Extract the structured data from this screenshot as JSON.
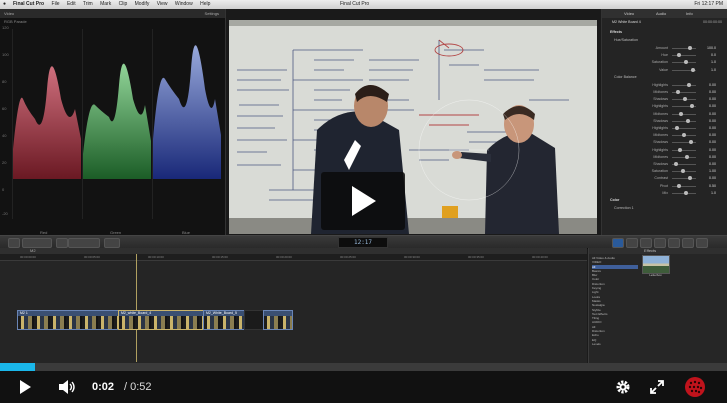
{
  "menubar": {
    "apple": "",
    "menus": [
      "Final Cut Pro",
      "File",
      "Edit",
      "Trim",
      "Mark",
      "Clip",
      "Modify",
      "View",
      "Window",
      "Help"
    ],
    "window_title": "Final Cut Pro",
    "clock": "Fri 12:17 PM"
  },
  "scopes": {
    "panel_label": "Video",
    "settings_label": "Settings",
    "scope_name": "RGB Parade",
    "scale": [
      "120",
      "100",
      "80",
      "60",
      "40",
      "20",
      "0",
      "-20"
    ],
    "channels": [
      "Red",
      "Green",
      "Blue"
    ],
    "colors": {
      "red": "#d8404a",
      "green": "#42c85a",
      "blue": "#5a7ae8"
    }
  },
  "viewer": {
    "whiteboard_notes": [
      "Voldemort",
      "McHugh Studios",
      "Tape Bros.",
      "Paid Society",
      "Crowd Funding",
      "Rochester",
      "Marketing",
      "Sales",
      "Film",
      "Bus. Plan",
      "Design Sheets"
    ]
  },
  "inspector": {
    "tabs": [
      "Video",
      "Audio",
      "Info"
    ],
    "clip_title": "M2 White Board 4",
    "clip_time": "00:00:00:00",
    "rows": [
      {
        "name": "Effects",
        "value": "",
        "kind": "head"
      },
      {
        "name": "Hue/Saturation",
        "value": "",
        "kind": "sec"
      },
      {
        "name": "Amount",
        "value": "100.0",
        "kind": "row"
      },
      {
        "name": "Hue",
        "value": "0.0",
        "kind": "row"
      },
      {
        "name": "Saturation",
        "value": "1.0",
        "kind": "row"
      },
      {
        "name": "Value",
        "value": "1.0",
        "kind": "row"
      },
      {
        "name": "Color Balance",
        "value": "",
        "kind": "sec"
      },
      {
        "name": "Highlights",
        "value": "0.00",
        "kind": "row"
      },
      {
        "name": "Midtones",
        "value": "0.00",
        "kind": "row"
      },
      {
        "name": "Shadows",
        "value": "0.00",
        "kind": "row"
      },
      {
        "name": "Highlights",
        "value": "0.00",
        "kind": "row"
      },
      {
        "name": "Midtones",
        "value": "0.00",
        "kind": "row"
      },
      {
        "name": "Shadows",
        "value": "0.00",
        "kind": "row"
      },
      {
        "name": "Highlights",
        "value": "0.00",
        "kind": "row"
      },
      {
        "name": "Midtones",
        "value": "0.00",
        "kind": "row"
      },
      {
        "name": "Shadows",
        "value": "0.00",
        "kind": "row"
      },
      {
        "name": "Highlights",
        "value": "0.00",
        "kind": "row"
      },
      {
        "name": "Midtones",
        "value": "0.00",
        "kind": "row"
      },
      {
        "name": "Shadows",
        "value": "0.00",
        "kind": "row"
      },
      {
        "name": "Saturation",
        "value": "1.00",
        "kind": "row"
      },
      {
        "name": "Contrast",
        "value": "0.00",
        "kind": "row"
      },
      {
        "name": "Pivot",
        "value": "0.50",
        "kind": "row"
      },
      {
        "name": "Mix",
        "value": "1.0",
        "kind": "row"
      },
      {
        "name": "Color",
        "value": "",
        "kind": "head"
      },
      {
        "name": "Correction 1",
        "value": "",
        "kind": "sec"
      }
    ]
  },
  "toolbar": {
    "timecode": "12:17"
  },
  "timeline": {
    "header": "M2",
    "ruler": [
      "00:00:00:00",
      "00:00:05:00",
      "00:00:10:00",
      "00:00:15:00",
      "00:00:20:00",
      "00:00:25:00",
      "00:00:30:00",
      "00:00:35:00",
      "00:00:40:00"
    ],
    "clips": [
      {
        "label": "M2 1"
      },
      {
        "label": "M2_white_Board_4"
      },
      {
        "label": "M2_White_Board_5"
      },
      {
        "label": ""
      }
    ]
  },
  "effects": {
    "header": "Effects",
    "categories": [
      "All Video & Audio",
      "VIDEO",
      "All",
      "Basics",
      "Blur",
      "Color",
      "Distortion",
      "Keying",
      "Light",
      "Looks",
      "Masks",
      "Nostalgia",
      "Stylize",
      "Text Effects",
      "Tiling",
      "AUDIO",
      "All",
      "Distortion",
      "Echo",
      "EQ",
      "Levels"
    ],
    "selected_index": 2,
    "thumb_label": "Letterbox"
  },
  "player": {
    "progress": 0.048,
    "time_current": "0:02",
    "time_total": "/ 0:52",
    "accent": "#1ab7ea"
  }
}
